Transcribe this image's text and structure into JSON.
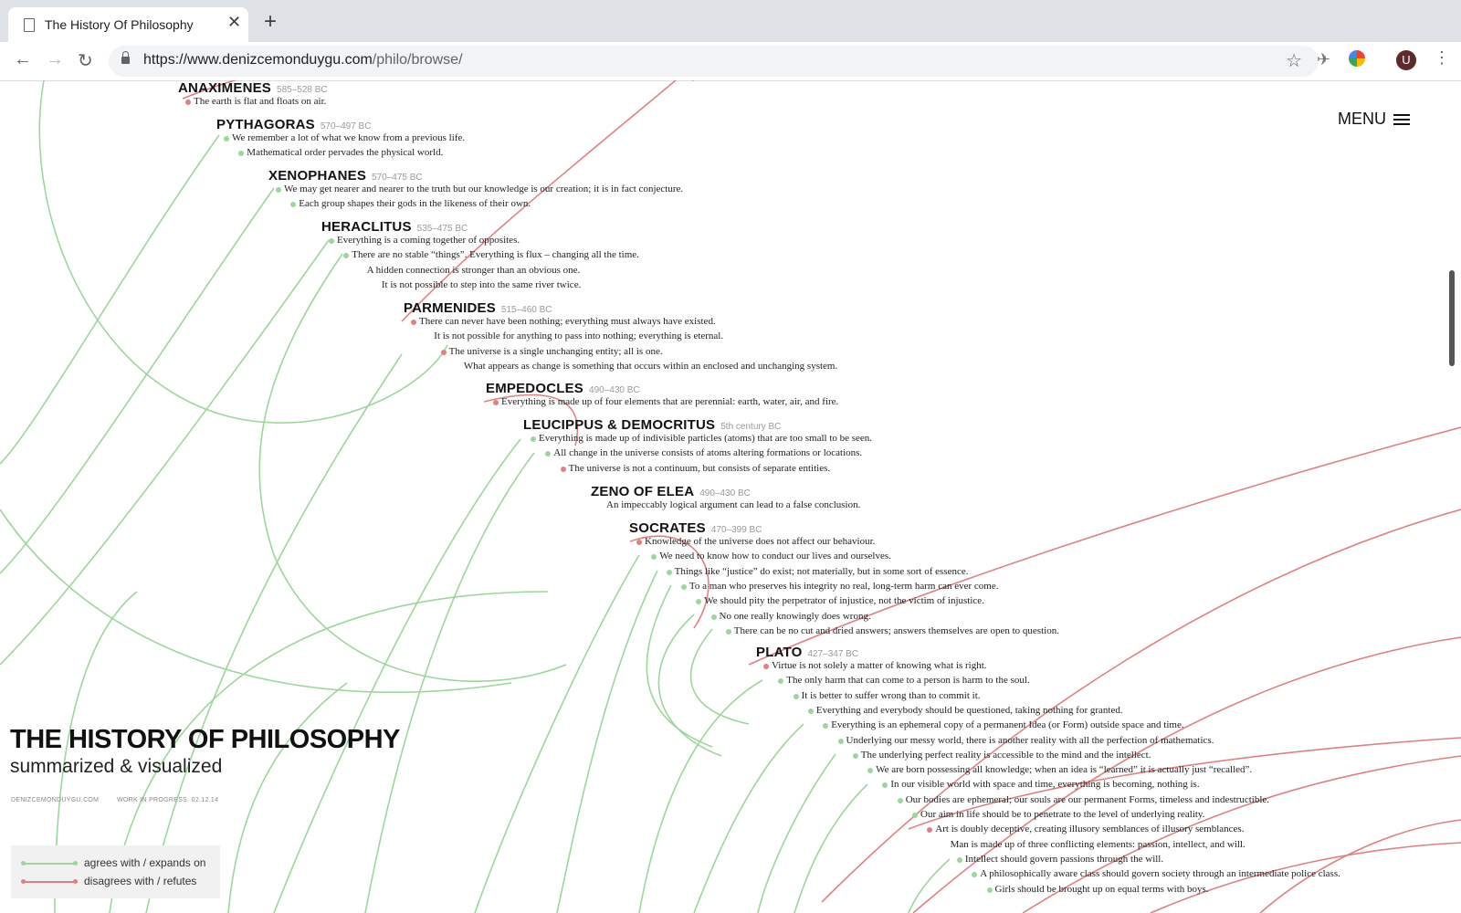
{
  "browser": {
    "tab_title": "The History Of Philosophy",
    "url_host": "https://www.denizcemonduygu.com",
    "url_path": "/philo/browse/",
    "avatar_letter": "U"
  },
  "menu_label": "MENU",
  "site": {
    "title": "THE HISTORY OF PHILOSOPHY",
    "subtitle": "summarized & visualized",
    "credit": "DENIZCEMONDUYGU.COM",
    "status": "WORK IN PROGRESS. 02.12.14"
  },
  "legend": {
    "agrees": "agrees with / expands on",
    "disagrees": "disagrees with / refutes",
    "agree_color": "#9bd79b",
    "disagree_color": "#e08080"
  },
  "philosophers": [
    {
      "name": "ANAXIMENES",
      "dates": "585–528 BC",
      "ideas": [
        {
          "text": "The earth is flat and floats on air.",
          "c": "r"
        }
      ]
    },
    {
      "name": "PYTHAGORAS",
      "dates": "570–497 BC",
      "ideas": [
        {
          "text": "We remember a lot of what we know from a previous life.",
          "c": "g"
        },
        {
          "text": "Mathematical order pervades the physical world.",
          "c": "g"
        }
      ]
    },
    {
      "name": "XENOPHANES",
      "dates": "570–475 BC",
      "ideas": [
        {
          "text": "We may get nearer and nearer to the truth but our knowledge is our creation; it is in fact conjecture.",
          "c": "g"
        },
        {
          "text": "Each group shapes their gods in the likeness of their own.",
          "c": "g"
        }
      ]
    },
    {
      "name": "HERACLITUS",
      "dates": "535–475 BC",
      "ideas": [
        {
          "text": "Everything is a coming together of opposites.",
          "c": "g"
        },
        {
          "text": "There are no stable “things”. Everything is flux – changing all the time.",
          "c": "g"
        },
        {
          "text": "A hidden connection is stronger than an obvious one.",
          "c": ""
        },
        {
          "text": "It is not possible to step into the same river twice.",
          "c": ""
        }
      ]
    },
    {
      "name": "PARMENIDES",
      "dates": "515–460 BC",
      "ideas": [
        {
          "text": "There can never have been nothing; everything must always have existed.",
          "c": "r"
        },
        {
          "text": "It is not possible for anything to pass into nothing; everything is eternal.",
          "c": ""
        },
        {
          "text": "The universe is a single unchanging entity; all is one.",
          "c": "r"
        },
        {
          "text": "What appears as change is something that occurs within an enclosed and unchanging system.",
          "c": ""
        }
      ]
    },
    {
      "name": "EMPEDOCLES",
      "dates": "490–430 BC",
      "ideas": [
        {
          "text": "Everything is made up of four elements that are perennial: earth, water, air, and fire.",
          "c": "r"
        }
      ]
    },
    {
      "name": "LEUCIPPUS & DEMOCRITUS",
      "dates": "5th century BC",
      "ideas": [
        {
          "text": "Everything is made up of indivisible particles (atoms) that are too small to be seen.",
          "c": "g"
        },
        {
          "text": "All change in the universe consists of atoms altering formations or locations.",
          "c": "g"
        },
        {
          "text": "The universe is not a continuum, but consists of separate entities.",
          "c": "r"
        }
      ]
    },
    {
      "name": "ZENO OF ELEA",
      "dates": "490–430 BC",
      "ideas": [
        {
          "text": "An impeccably logical argument can lead to a false conclusion.",
          "c": ""
        }
      ]
    },
    {
      "name": "SOCRATES",
      "dates": "470–399 BC",
      "ideas": [
        {
          "text": "Knowledge of the universe does not affect our behaviour.",
          "c": "r"
        },
        {
          "text": "We need to know how to conduct our lives and ourselves.",
          "c": "g"
        },
        {
          "text": "Things like “justice” do exist; not materially, but in some sort of essence.",
          "c": "g"
        },
        {
          "text": "To a man who preserves his integrity no real, long-term harm can ever come.",
          "c": "g"
        },
        {
          "text": "We should pity the perpetrator of injustice, not the victim of injustice.",
          "c": "g"
        },
        {
          "text": "No one really knowingly does wrong.",
          "c": "g"
        },
        {
          "text": "There can be no cut and dried answers; answers themselves are open to question.",
          "c": "g"
        }
      ]
    },
    {
      "name": "PLATO",
      "dates": "427–347 BC",
      "ideas": [
        {
          "text": "Virtue is not solely a matter of knowing what is right.",
          "c": "r"
        },
        {
          "text": "The only harm that can come to a person is harm to the soul.",
          "c": "g"
        },
        {
          "text": "It is better to suffer wrong than to commit it.",
          "c": "g"
        },
        {
          "text": "Everything and everybody should be questioned, taking nothing for granted.",
          "c": "g"
        },
        {
          "text": "Everything is an ephemeral copy of a permanent Idea (or Form) outside space and time.",
          "c": "g"
        },
        {
          "text": "Underlying our messy world, there is another reality with all the perfection of mathematics.",
          "c": "g"
        },
        {
          "text": "The underlying perfect reality is accessible to the mind and the intellect.",
          "c": "g"
        },
        {
          "text": "We are born possessing all knowledge; when an idea is “learned” it is actually just “recalled”.",
          "c": "g"
        },
        {
          "text": "In our visible world with space and time, everything is becoming, nothing is.",
          "c": "g"
        },
        {
          "text": "Our bodies are ephemeral; our souls are our permanent Forms, timeless and indestructible.",
          "c": "g"
        },
        {
          "text": "Our aim in life should be to penetrate to the level of underlying reality.",
          "c": "g"
        },
        {
          "text": "Art is doubly deceptive, creating illusory semblances of illusory semblances.",
          "c": "r"
        },
        {
          "text": "Man is made up of three conflicting elements: passion, intellect, and will.",
          "c": ""
        },
        {
          "text": "Intellect should govern passions through the will.",
          "c": "g"
        },
        {
          "text": "A philosophically aware class should govern society through an intermediate police class.",
          "c": "g"
        },
        {
          "text": "Girls should be brought up on equal terms with boys.",
          "c": "g"
        }
      ]
    }
  ]
}
